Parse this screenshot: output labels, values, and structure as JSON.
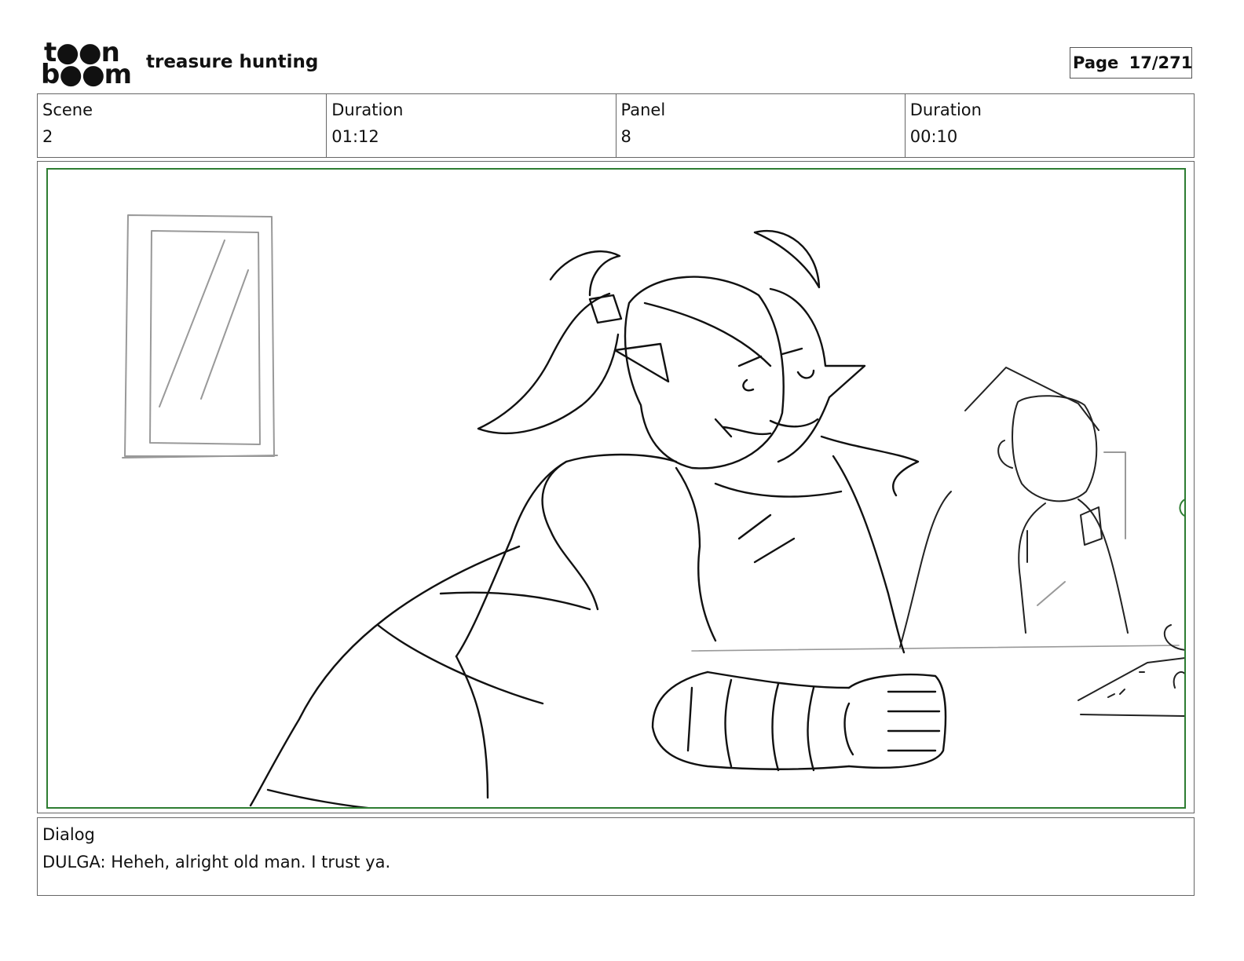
{
  "logo": {
    "line1": "t●●n",
    "line2": "b●●m"
  },
  "project": {
    "title": "treasure hunting"
  },
  "page": {
    "label": "Page",
    "number": "17/271"
  },
  "info": {
    "scene_label": "Scene",
    "scene_value": "2",
    "scene_duration_label": "Duration",
    "scene_duration_value": "01:12",
    "panel_label": "Panel",
    "panel_value": "8",
    "panel_duration_label": "Duration",
    "panel_duration_value": "00:10"
  },
  "dialog": {
    "label": "Dialog",
    "text": "DULGA: Heheh, alright old man. I trust ya."
  },
  "colors": {
    "safe_area": "#2e7d32",
    "border": "#666666",
    "sketch_ink": "#111111",
    "sketch_light": "#999999"
  }
}
